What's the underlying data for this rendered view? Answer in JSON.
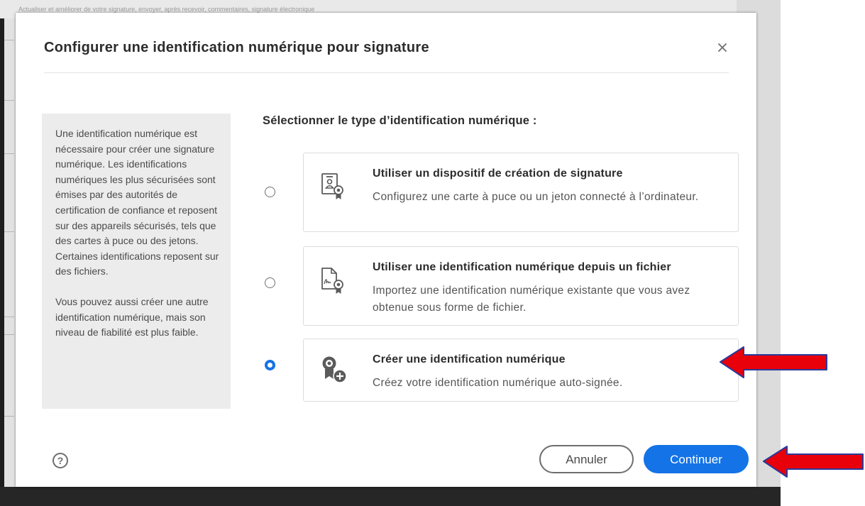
{
  "background": {
    "toolbar_text": "Actualiser et améliorer de votre signature, envoyer, après recevoir, commentaires, signature électronique"
  },
  "dialog": {
    "title": "Configurer une identification numérique pour signature",
    "close_icon": "close-icon",
    "info_paragraph_1": "Une identification numérique est nécessaire pour créer une signature numérique. Les identifications numériques les plus sécurisées sont émises par des autorités de certification de confiance et reposent sur des appareils sécurisés, tels que des cartes à puce ou des jetons. Certaines identifications reposent sur des fichiers.",
    "info_paragraph_2": "Vous pouvez aussi créer une autre identification numérique, mais son niveau de fiabilité est plus faible.",
    "heading": "Sélectionner le type d’identification numérique :",
    "options": [
      {
        "title": "Utiliser un dispositif de création de signature",
        "description": "Configurez une carte à puce ou un jeton connecté à l’ordinateur.",
        "icon": "id-badge-certificate-icon",
        "selected": false
      },
      {
        "title": "Utiliser une identification numérique depuis un fichier",
        "description": "Importez une identification numérique existante que vous avez obtenue sous forme de fichier.",
        "icon": "signed-file-certificate-icon",
        "selected": false
      },
      {
        "title": "Créer une identification numérique",
        "description": "Créez votre identification numérique auto-signée.",
        "icon": "certificate-add-icon",
        "selected": true
      }
    ],
    "help_icon": "help-icon",
    "help_glyph": "?",
    "cancel_label": "Annuler",
    "continue_label": "Continuer"
  },
  "colors": {
    "accent": "#1473e6",
    "annotation_arrow": "#e8000b"
  }
}
